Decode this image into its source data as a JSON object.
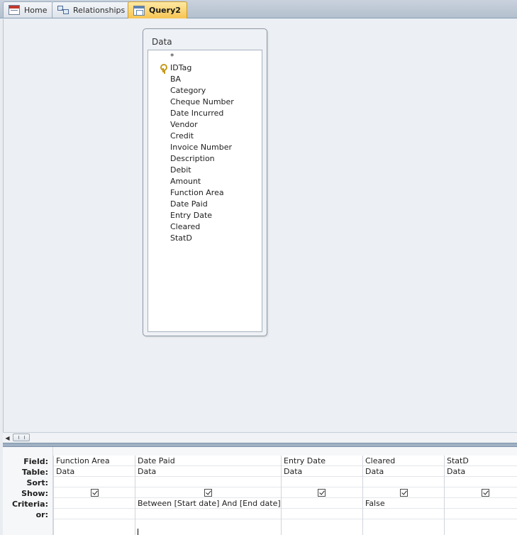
{
  "tabs": [
    {
      "label": "Home",
      "icon": "form-icon"
    },
    {
      "label": "Relationships",
      "icon": "relationships-icon"
    },
    {
      "label": "Query2",
      "icon": "query-icon",
      "active": true
    }
  ],
  "table_box": {
    "title": "Data",
    "fields": [
      "*",
      "IDTag",
      "BA",
      "Category",
      "Cheque Number",
      "Date Incurred",
      "Vendor",
      "Credit",
      "Invoice Number",
      "Description",
      "Debit",
      "Amount",
      "Function Area",
      "Date Paid",
      "Entry Date",
      "Cleared",
      "StatD"
    ],
    "primary_key": "IDTag"
  },
  "grid": {
    "row_labels": {
      "field": "Field:",
      "table": "Table:",
      "sort": "Sort:",
      "show": "Show:",
      "criteria": "Criteria:",
      "or": "or:"
    },
    "columns": [
      {
        "field": "Function Area",
        "table": "Data",
        "sort": "",
        "show": true,
        "criteria": "",
        "or": ""
      },
      {
        "field": "Date Paid",
        "table": "Data",
        "sort": "",
        "show": true,
        "criteria": "Between [Start date] And [End date]",
        "or": ""
      },
      {
        "field": "Entry Date",
        "table": "Data",
        "sort": "",
        "show": true,
        "criteria": "",
        "or": ""
      },
      {
        "field": "Cleared",
        "table": "Data",
        "sort": "",
        "show": true,
        "criteria": "False",
        "or": ""
      },
      {
        "field": "StatD",
        "table": "Data",
        "sort": "",
        "show": true,
        "criteria": "",
        "or": ""
      }
    ]
  },
  "scrollbar": {
    "left_arrow": "◀"
  }
}
